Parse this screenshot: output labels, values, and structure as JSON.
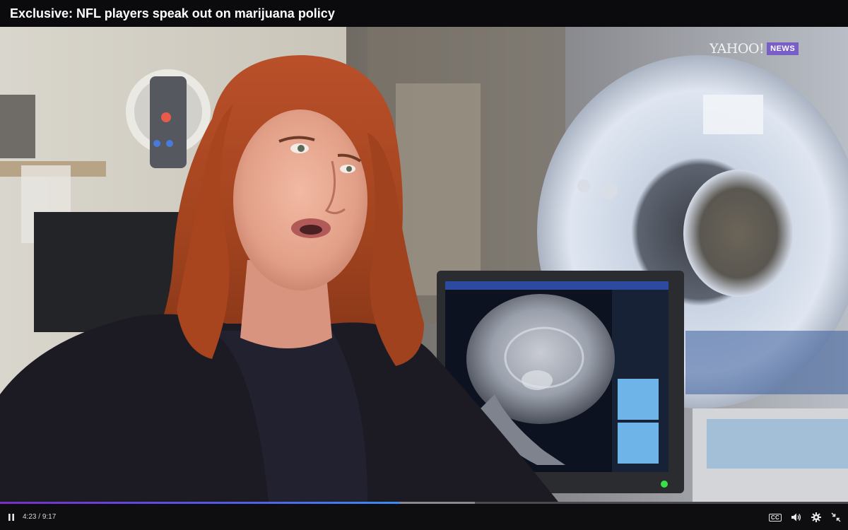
{
  "video": {
    "title": "Exclusive: NFL players speak out on marijuana policy"
  },
  "watermark": {
    "brand": "YAHOO!",
    "section": "NEWS"
  },
  "controls": {
    "current_time": "4:23",
    "duration": "9:17",
    "time_display": "4:23 / 9:17",
    "played_fraction": 0.472,
    "buffered_fraction": 0.56,
    "cc_label": "CC",
    "play_state": "playing",
    "icons": [
      "pause-icon",
      "closed-captions-icon",
      "volume-icon",
      "settings-gear-icon",
      "exit-fullscreen-icon"
    ]
  },
  "colors": {
    "progress_start": "#7b2cc9",
    "progress_end": "#3d8cf0",
    "news_badge": "#6e50c8"
  }
}
